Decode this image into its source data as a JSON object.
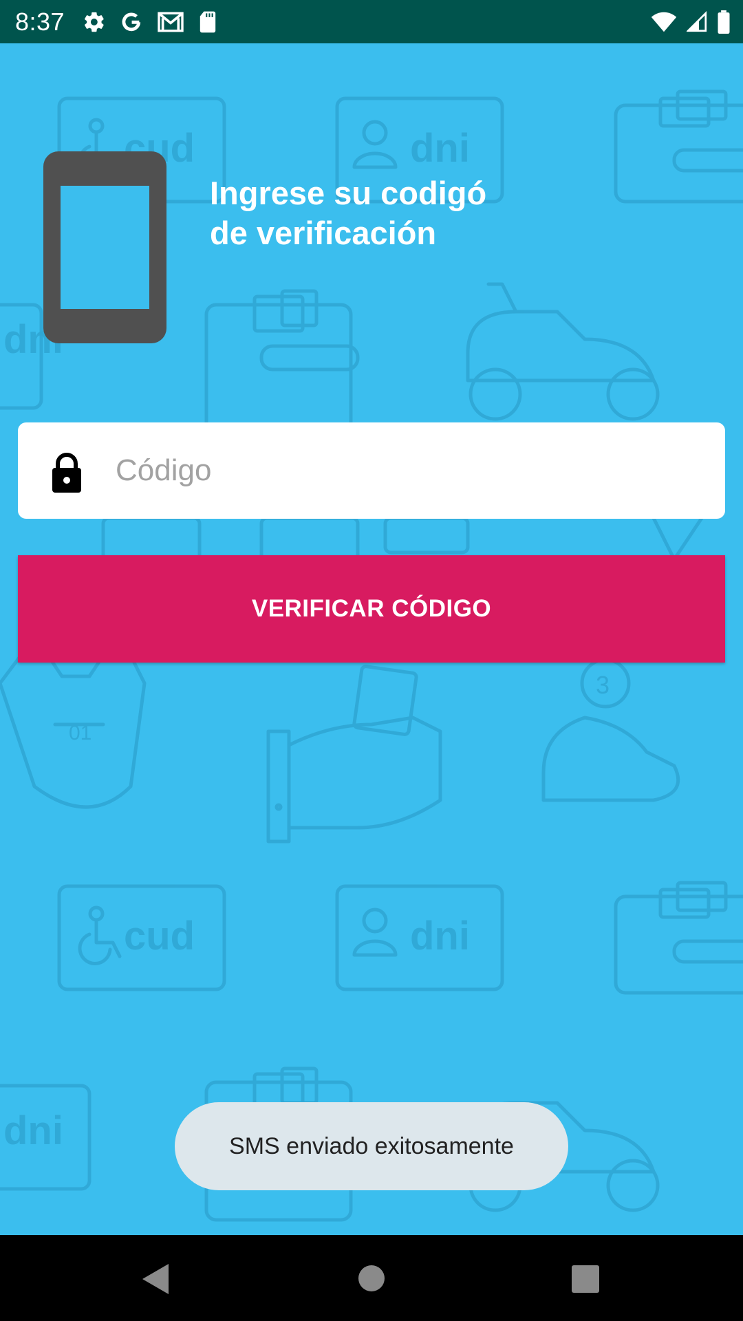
{
  "status_bar": {
    "time": "8:37",
    "icons": [
      "settings-icon",
      "google-icon",
      "gmail-icon",
      "sd-card-icon",
      "wifi-icon",
      "signal-icon",
      "battery-icon"
    ]
  },
  "header": {
    "title_line1": "Ingrese su codigó",
    "title_line2": "de verificación"
  },
  "form": {
    "code_placeholder": "Código",
    "code_value": "",
    "verify_label": "VERIFICAR CÓDIGO"
  },
  "toast": {
    "message": "SMS enviado exitosamente"
  },
  "background_pattern": {
    "labels": [
      "cud",
      "dni",
      "dni",
      "01",
      "3",
      "cud",
      "dni",
      "dni"
    ]
  },
  "colors": {
    "background": "#3bbeee",
    "status_bar": "#00544d",
    "accent": "#d81b60",
    "phone_graphic": "#505050"
  }
}
